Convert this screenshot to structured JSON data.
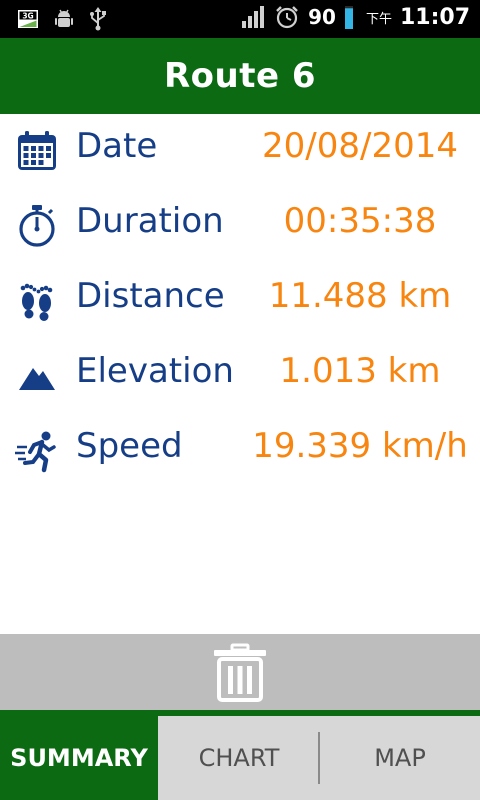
{
  "status_bar": {
    "left_icons": [
      "3g-sim-icon",
      "android-debug-icon",
      "usb-icon"
    ],
    "signal_icon": "signal-bars-icon",
    "alarm_icon": "alarm-clock-icon",
    "battery_level": "90",
    "battery_fraction": 0.9,
    "ampm": "下午",
    "time": "11:07",
    "sim_label": "3G"
  },
  "header": {
    "title": "Route 6",
    "color": "#0b6a12"
  },
  "summary": {
    "rows": [
      {
        "icon": "calendar-icon",
        "label": "Date",
        "value": "20/08/2014"
      },
      {
        "icon": "stopwatch-icon",
        "label": "Duration",
        "value": "00:35:38"
      },
      {
        "icon": "footprints-icon",
        "label": "Distance",
        "value": "11.488 km"
      },
      {
        "icon": "mountain-icon",
        "label": "Elevation",
        "value": "1.013 km"
      },
      {
        "icon": "runner-icon",
        "label": "Speed",
        "value": "19.339 km/h"
      }
    ],
    "label_color": "#163e87",
    "value_color": "#f7850f"
  },
  "actions": {
    "delete_icon": "trash-icon"
  },
  "tabs": [
    {
      "label": "SUMMARY",
      "active": true
    },
    {
      "label": "CHART",
      "active": false
    },
    {
      "label": "MAP",
      "active": false
    }
  ]
}
